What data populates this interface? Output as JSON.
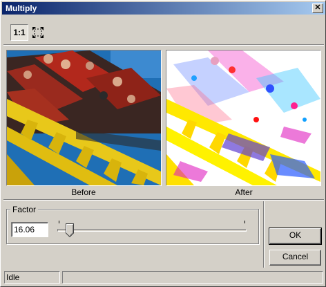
{
  "window": {
    "title": "Multiply",
    "close_glyph": "✕"
  },
  "toolbar": {
    "actual_size_label": "1:1",
    "actual_size_active": true,
    "fit_icon": "fit-to-window-icon"
  },
  "preview": {
    "before_label": "Before",
    "after_label": "After",
    "colors": {
      "sky": "#1f6fb5",
      "track_yellow": "#e8c81a",
      "car_red": "#b2281c",
      "after_bg": "#ffffff",
      "after_yellow": "#ffe800",
      "after_blue": "#2a5bff",
      "after_magenta": "#e020c0"
    }
  },
  "factor": {
    "group_label": "Factor",
    "value": "16.06",
    "slider_position": 0.06
  },
  "buttons": {
    "ok": "OK",
    "cancel": "Cancel"
  },
  "status": {
    "text": "Idle",
    "secondary": ""
  }
}
